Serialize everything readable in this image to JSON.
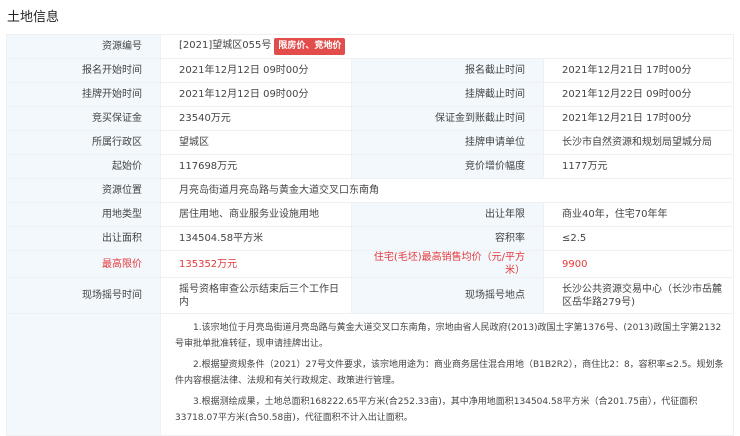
{
  "title": "土地信息",
  "resource_no": {
    "label": "资源编号",
    "value": "[2021]望城区055号",
    "badge": "限房价、竞地价"
  },
  "rows": [
    {
      "l1": "报名开始时间",
      "v1": "2021年12月12日 09时00分",
      "l2": "报名截止时间",
      "v2": "2021年12月21日 17时00分"
    },
    {
      "l1": "挂牌开始时间",
      "v1": "2021年12月12日 09时00分",
      "l2": "挂牌截止时间",
      "v2": "2021年12月22日 09时00分"
    },
    {
      "l1": "竞买保证金",
      "v1": "23540万元",
      "l2": "保证金到账截止时间",
      "v2": "2021年12月21日 17时00分"
    },
    {
      "l1": "所属行政区",
      "v1": "望城区",
      "l2": "挂牌申请单位",
      "v2": "长沙市自然资源和规划局望城分局"
    },
    {
      "l1": "起始价",
      "v1": "117698万元",
      "l2": "竞价增价幅度",
      "v2": "1177万元"
    }
  ],
  "location": {
    "label": "资源位置",
    "value": "月亮岛街道月亮岛路与黄金大道交叉口东南角"
  },
  "rows2": [
    {
      "l1": "用地类型",
      "v1": "居住用地、商业服务业设施用地",
      "l2": "出让年限",
      "v2": "商业40年，住宅70年年"
    },
    {
      "l1": "出让面积",
      "v1": "134504.58平方米",
      "l2": "容积率",
      "v2": "≤2.5"
    },
    {
      "l1": "最高限价",
      "v1": "135352万元",
      "l2": "住宅(毛坯)最高销售均价（元/平方米）",
      "v2": "9900"
    },
    {
      "l1": "现场摇号时间",
      "v1": "摇号资格审查公示结束后三个工作日内",
      "l2": "现场摇号地点",
      "v2": "长沙公共资源交易中心（长沙市岳麓区岳华路279号)"
    }
  ],
  "notes": [
    "1.该宗地位于月亮岛街道月亮岛路与黄金大道交叉口东南角，宗地由省人民政府(2013)政国土字第1376号、(2013)政国土字第2132号审批单批准转征，现申请挂牌出让。",
    "2.根据望资规条件（2021）27号文件要求，该宗地用途为：商业商务居住混合用地（B1B2R2），商住比2：8，容积率≤2.5。规划条件内容根据法律、法规和有关行政规定、政策进行管理。",
    "3.根据测绘成果，土地总面积168222.65平方米(合252.33亩)，其中净用地面积134504.58平方米（合201.75亩），代征面积33718.07平方米(合50.58亩)，代征面积不计入出让面积。"
  ]
}
